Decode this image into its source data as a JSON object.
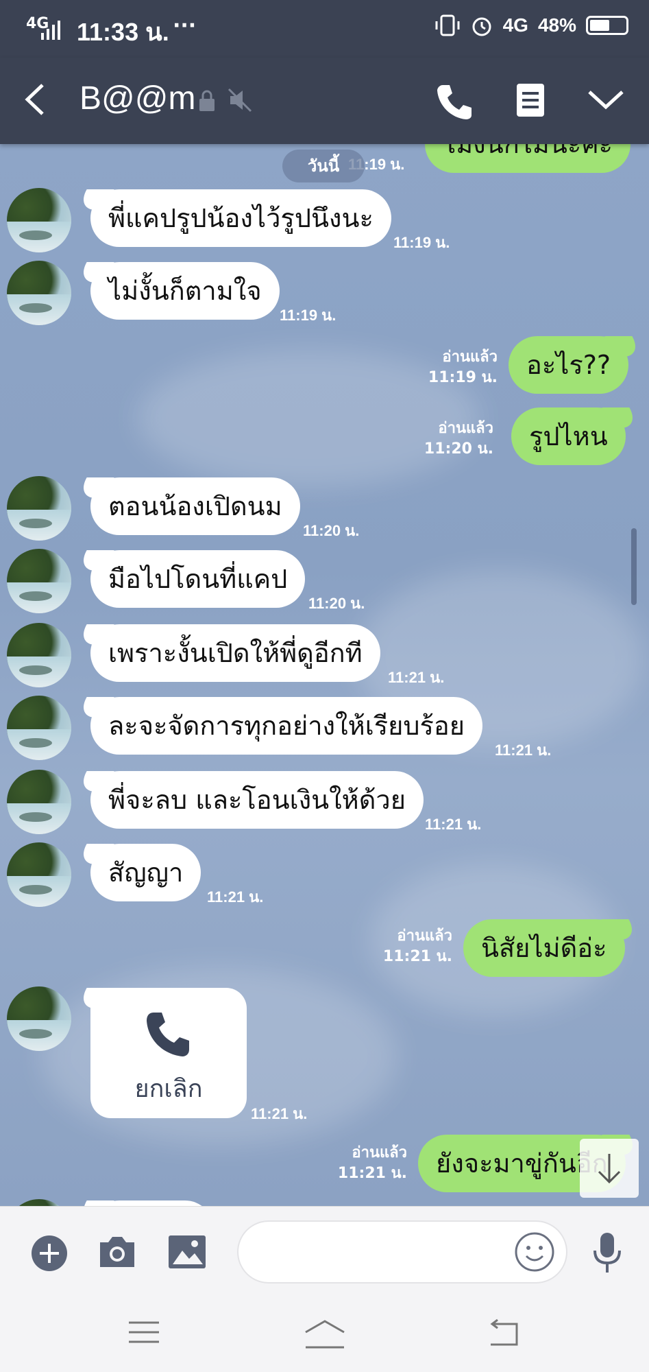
{
  "status_bar": {
    "network": "4G",
    "time": "11:33 น.",
    "more": "···",
    "net2": "4G",
    "battery": "48%"
  },
  "header": {
    "title": "B@@m"
  },
  "date_pill": "วันนี้",
  "top_partial": {
    "time": "11:19 น.",
    "text": "ไม่งั้นก็ไม่นะคะ"
  },
  "messages": [
    {
      "dir": "in",
      "text": "พี่แคปรูปน้องไว้รูปนึงนะ",
      "time": "11:19 น."
    },
    {
      "dir": "in",
      "text": "ไม่งั้นก็ตามใจ",
      "time": "11:19 น."
    },
    {
      "dir": "out",
      "text": "อะไร??",
      "time": "11:19 น.",
      "read": "อ่านแล้ว"
    },
    {
      "dir": "out",
      "text": "รูปไหน",
      "time": "11:20 น.",
      "read": "อ่านแล้ว"
    },
    {
      "dir": "in",
      "text": "ตอนน้องเปิดนม",
      "time": "11:20 น."
    },
    {
      "dir": "in",
      "text": "มือไปโดนที่แคป",
      "time": "11:20 น."
    },
    {
      "dir": "in",
      "text": "เพราะงั้นเปิดให้พี่ดูอีกที",
      "time": "11:21 น."
    },
    {
      "dir": "in",
      "text": "ละจะจัดการทุกอย่างให้เรียบร้อย",
      "time": "11:21 น."
    },
    {
      "dir": "in",
      "text": "พี่จะลบ และโอนเงินให้ด้วย",
      "time": "11:21 น."
    },
    {
      "dir": "in",
      "text": "สัญญา",
      "time": "11:21 น."
    },
    {
      "dir": "out",
      "text": "นิสัยไม่ดีอ่ะ",
      "time": "11:21 น.",
      "read": "อ่านแล้ว"
    },
    {
      "dir": "out",
      "text": "ยังจะมาขู่กันอีก",
      "time": "11:21 น.",
      "read": "อ่านแล้ว"
    }
  ],
  "call_card": {
    "label": "ยกเลิก",
    "time": "11:21 น."
  },
  "icons": {
    "back": "chevron-left-icon",
    "lock": "lock-icon",
    "mute": "mute-icon",
    "call": "phone-icon",
    "notes": "notes-icon",
    "expand": "chevron-down-icon",
    "add": "plus-icon",
    "camera": "camera-icon",
    "gallery": "image-icon",
    "emoji": "smiley-icon",
    "mic": "microphone-icon",
    "scroll_down": "arrow-down-icon"
  },
  "colors": {
    "header": "#3b4253",
    "bubble_out": "#a0e275",
    "bubble_in": "#ffffff",
    "chat_bg": "#8aa0c2"
  }
}
